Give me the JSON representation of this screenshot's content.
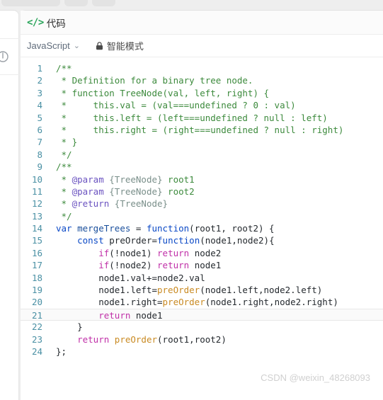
{
  "window": {
    "background_color": "#eeeeee",
    "top_chips": [
      "",
      "",
      ""
    ]
  },
  "left_rail": {
    "icon": "circle-icon"
  },
  "panel": {
    "header": {
      "icon_label": "</>",
      "title": "代码"
    },
    "toolbar": {
      "language": "JavaScript",
      "chevron": "⌄",
      "lock_icon": "lock-icon",
      "mode_label": "智能模式"
    }
  },
  "editor": {
    "active_line": 21,
    "colors": {
      "comment": "#3c8a3c",
      "jsdoc_tag": "#6a52c0",
      "jsdoc_type": "#7a8f8a",
      "keyword": "#0b49c6",
      "control_keyword": "#c030a8",
      "function_name": "#1a4f9c",
      "call": "#c98a22",
      "text": "#24292e",
      "line_number": "#4a90a4"
    },
    "lines": [
      {
        "n": "1",
        "text": "/**"
      },
      {
        "n": "2",
        "text": " * Definition for a binary tree node."
      },
      {
        "n": "3",
        "text": " * function TreeNode(val, left, right) {"
      },
      {
        "n": "4",
        "text": " *     this.val = (val===undefined ? 0 : val)"
      },
      {
        "n": "5",
        "text": " *     this.left = (left===undefined ? null : left)"
      },
      {
        "n": "6",
        "text": " *     this.right = (right===undefined ? null : right)"
      },
      {
        "n": "7",
        "text": " * }"
      },
      {
        "n": "8",
        "text": " */"
      },
      {
        "n": "9",
        "text": "/**"
      },
      {
        "n": "10",
        "text": " * @param {TreeNode} root1"
      },
      {
        "n": "11",
        "text": " * @param {TreeNode} root2"
      },
      {
        "n": "12",
        "text": " * @return {TreeNode}"
      },
      {
        "n": "13",
        "text": " */"
      },
      {
        "n": "14",
        "text": "var mergeTrees = function(root1, root2) {"
      },
      {
        "n": "15",
        "text": "    const preOrder=function(node1,node2){"
      },
      {
        "n": "16",
        "text": "        if(!node1) return node2"
      },
      {
        "n": "17",
        "text": "        if(!node2) return node1"
      },
      {
        "n": "18",
        "text": "        node1.val+=node2.val"
      },
      {
        "n": "19",
        "text": "        node1.left=preOrder(node1.left,node2.left)"
      },
      {
        "n": "20",
        "text": "        node1.right=preOrder(node1.right,node2.right)"
      },
      {
        "n": "21",
        "text": "        return node1"
      },
      {
        "n": "22",
        "text": "    }"
      },
      {
        "n": "23",
        "text": "    return preOrder(root1,root2)"
      },
      {
        "n": "24",
        "text": "};"
      }
    ]
  },
  "watermark": {
    "text": "CSDN @weixin_48268093"
  }
}
